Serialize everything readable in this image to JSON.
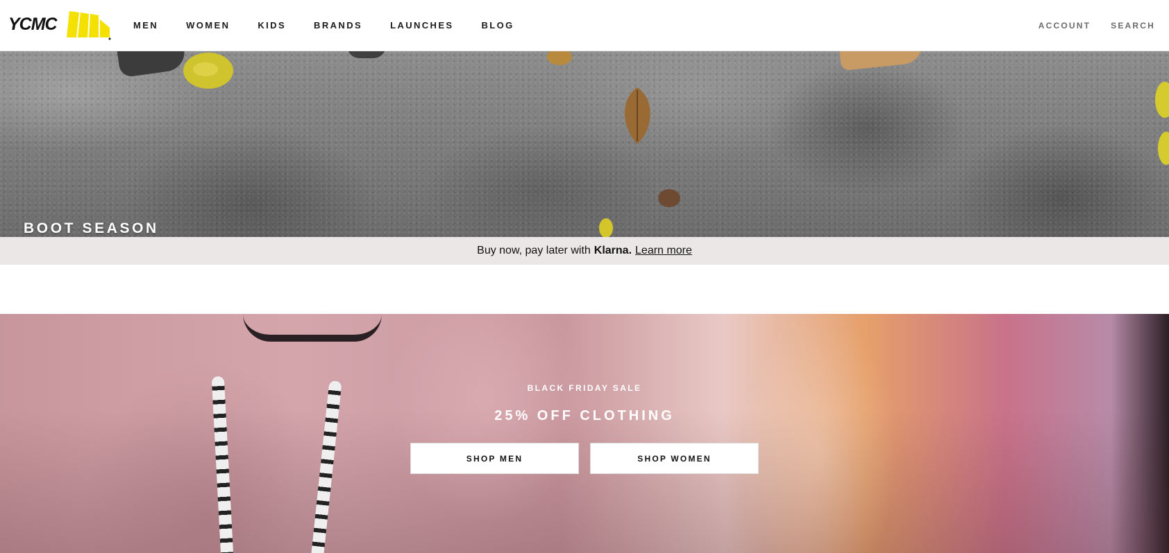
{
  "header": {
    "logo_text": "YCMC",
    "nav": [
      "MEN",
      "WOMEN",
      "KIDS",
      "BRANDS",
      "LAUNCHES",
      "BLOG"
    ],
    "account_label": "ACCOUNT",
    "search_label": "SEARCH"
  },
  "hero_boot": {
    "title": "BOOT SEASON"
  },
  "klarna_banner": {
    "text": "Buy now, pay later with",
    "brand": "Klarna.",
    "link": "Learn more"
  },
  "hero_sale": {
    "kicker": "BLACK FRIDAY SALE",
    "title": "25% OFF CLOTHING",
    "button_men": "SHOP MEN",
    "button_women": "SHOP WOMEN"
  },
  "colors": {
    "logo_yellow": "#f5e100",
    "klarna_bg": "#ebe7e6",
    "text_dark": "#1b1b1b"
  }
}
